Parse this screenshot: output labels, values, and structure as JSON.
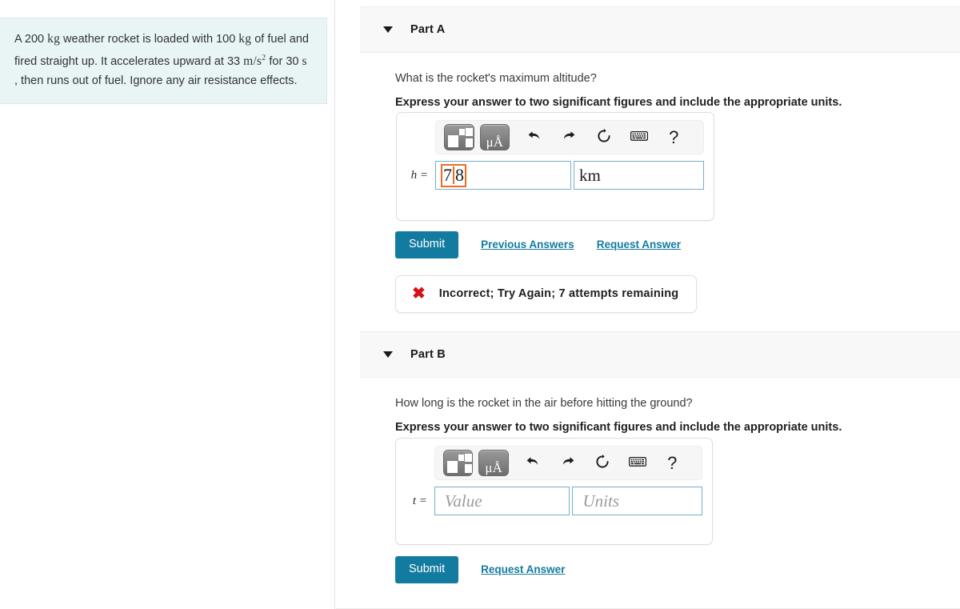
{
  "problem": {
    "text_lines": [
      "A 200 kg weather rocket is loaded with 100 kg of fuel",
      "and fired straight up. It accelerates upward at 33 m/s²",
      "for 30 s , then runs out of fuel. Ignore any air",
      "resistance effects."
    ],
    "mass_rocket": "200 kg",
    "mass_fuel": "100 kg",
    "acceleration": "33 m/s²",
    "burn_time": "30 s"
  },
  "toolbar": {
    "template_icon": "math-template-icon",
    "units_label": "μÅ",
    "undo_icon": "↰",
    "redo_icon": "↱",
    "reset_icon": "⟳",
    "keyboard_icon": "keyboard-icon",
    "help_icon": "?"
  },
  "colors": {
    "accent": "#137b9f",
    "field_border": "#74afc9",
    "selection": "#ed6d20",
    "error": "#d8101a",
    "problem_bg": "#e9f5f5",
    "header_bg": "#f8f8f8"
  },
  "parts": [
    {
      "id": "part-a",
      "label": "Part A",
      "question": "What is the rocket's maximum altitude?",
      "instruction": "Express your answer to two significant figures and include the appropriate units.",
      "variable": "h  =",
      "value": "78",
      "value_digits": [
        "7",
        "8"
      ],
      "units": "km",
      "value_placeholder": "Value",
      "units_placeholder": "Units",
      "submit_label": "Submit",
      "previous_answers_label": "Previous Answers",
      "request_answer_label": "Request Answer",
      "feedback": {
        "icon": "x-mark-icon",
        "text": "Incorrect; Try Again; 7 attempts remaining",
        "attempts_remaining": 7
      }
    },
    {
      "id": "part-b",
      "label": "Part B",
      "question": "How long is the rocket in the air before hitting the ground?",
      "instruction": "Express your answer to two significant figures and include the appropriate units.",
      "variable": "t  =",
      "value": "",
      "units": "",
      "value_placeholder": "Value",
      "units_placeholder": "Units",
      "submit_label": "Submit",
      "request_answer_label": "Request Answer"
    }
  ]
}
